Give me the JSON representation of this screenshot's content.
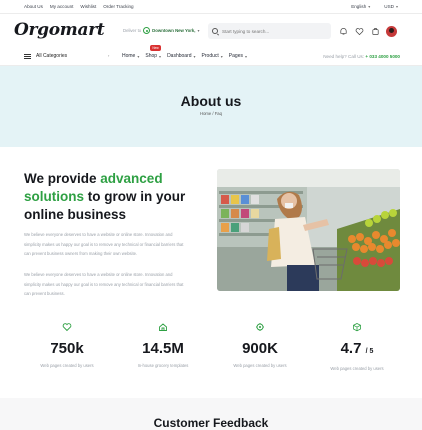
{
  "topbar": {
    "links": [
      "About Us",
      "My account",
      "Wishlist",
      "Order Tracking"
    ],
    "language": "English",
    "currency": "USD"
  },
  "header": {
    "logo": "Orgomart",
    "deliver_label": "Deliver to",
    "location": "Downtown New York,",
    "search_placeholder": "Start typing to search..."
  },
  "nav": {
    "categories_label": "All Categories",
    "items": [
      {
        "label": "Home",
        "badge": ""
      },
      {
        "label": "Shop",
        "badge": "New"
      },
      {
        "label": "Dashboard",
        "badge": ""
      },
      {
        "label": "Product",
        "badge": ""
      },
      {
        "label": "Pages",
        "badge": ""
      }
    ],
    "help_label": "Need help? Call Us:",
    "help_phone": "+ 033 4000 5000"
  },
  "hero": {
    "title": "About us",
    "breadcrumb": "Home / Faq"
  },
  "about": {
    "heading_1": "We provide ",
    "heading_green": "advanced solutions",
    "heading_2": " to grow in your online business",
    "paragraph_1": "We believe everyone deserves to have a website or online store. Innovation and simplicity makes us happy our goal is to remove any technical or financial barriers that can prevent business owners from making their own website.",
    "paragraph_2": "We believe everyone deserves to have a website or online store. Innovation and simplicity makes us happy our goal is to remove any technical or financial barriers that can prevent business."
  },
  "stats": [
    {
      "icon": "heart-icon",
      "value": "750k",
      "suffix": "",
      "label": "Web pages created by users"
    },
    {
      "icon": "home-icon",
      "value": "14.5M",
      "suffix": "",
      "label": "In-house grocery templates"
    },
    {
      "icon": "gear-icon",
      "value": "900K",
      "suffix": "",
      "label": "Web pages created by users"
    },
    {
      "icon": "box-icon",
      "value": "4.7",
      "suffix": "/ 5",
      "label": "Web pages created by users"
    }
  ],
  "feedback": {
    "title": "Customer Feedback"
  },
  "colors": {
    "accent": "#2ea043",
    "hero_bg": "#e4f3f6",
    "badge": "#d93030"
  }
}
